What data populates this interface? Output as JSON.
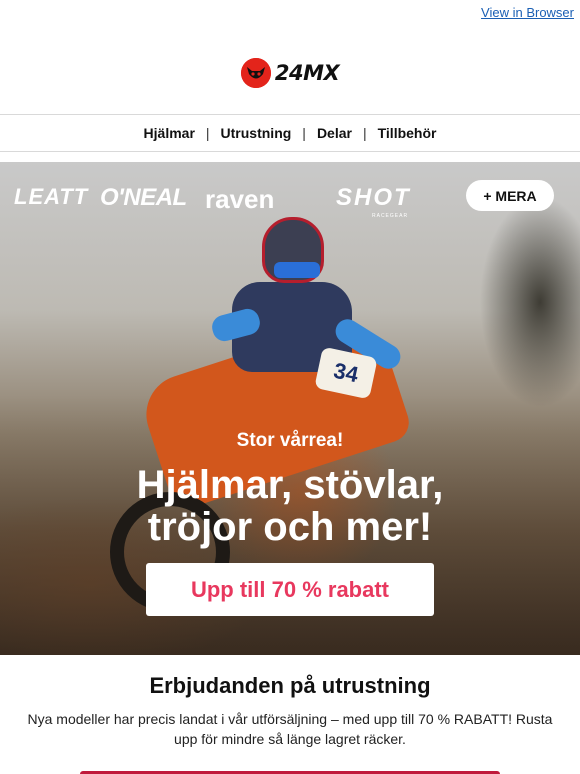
{
  "header": {
    "view_in_browser": "View in Browser"
  },
  "logo": {
    "text": "24MX"
  },
  "nav": {
    "items": [
      "Hjälmar",
      "Utrustning",
      "Delar",
      "Tillbehör"
    ],
    "separator": "|"
  },
  "hero": {
    "brands": [
      "LEATT",
      "O'NEAL",
      "raven",
      "SHOT"
    ],
    "brand_sub": "RACEGEAR",
    "more_button": "+ MERA",
    "number_plate": "34",
    "eyebrow": "Stor vårrea!",
    "headline_line1": "Hjälmar, stövlar,",
    "headline_line2": "tröjor och mer!",
    "cta": "Upp till 70 % rabatt"
  },
  "section": {
    "title": "Erbjudanden på utrustning",
    "text": "Nya modeller har precis landat i vår utförsäljning – med upp till 70 % RABATT! Rusta upp för mindre så länge lagret räcker."
  },
  "colors": {
    "accent": "#e8385e",
    "brand_red": "#e3241b",
    "bar": "#c01a3c",
    "link": "#1a5fb4"
  }
}
